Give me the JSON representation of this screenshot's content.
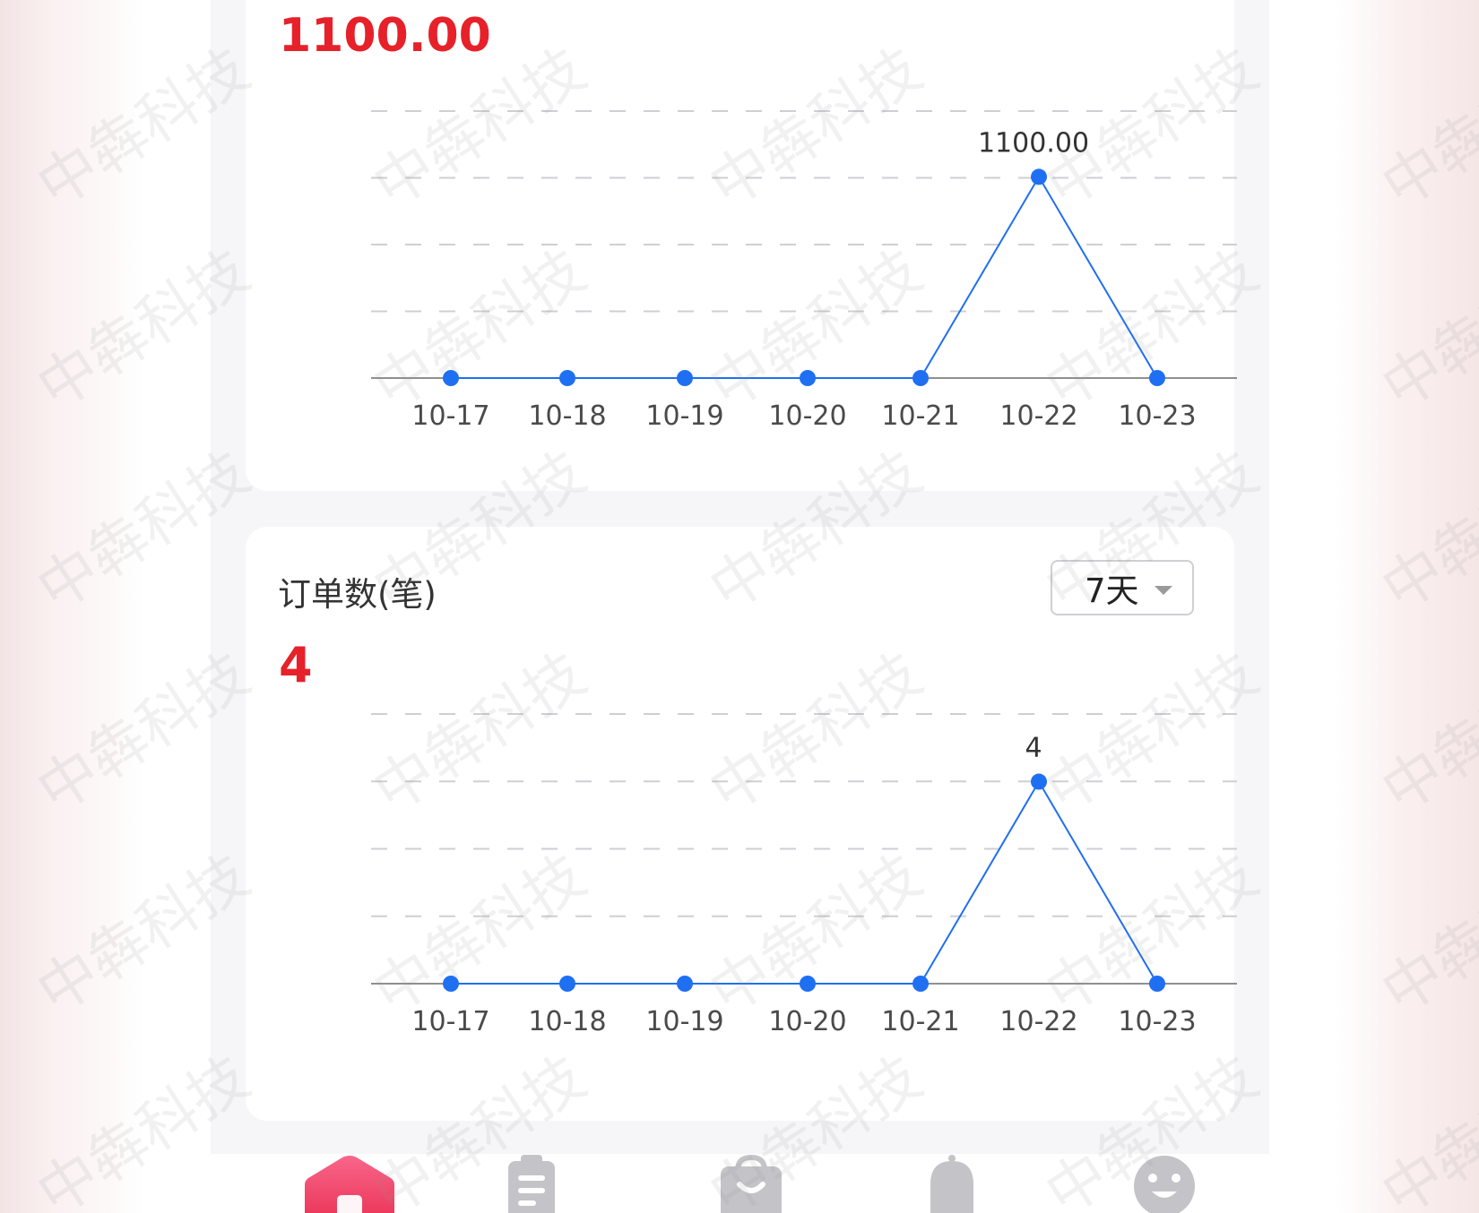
{
  "watermark_text": "中犇科技",
  "sales_card": {
    "value": "1100.00"
  },
  "orders_card": {
    "title": "订单数(笔)",
    "value": "4",
    "range_selected": "7天"
  },
  "chart_data": [
    {
      "type": "line",
      "categories": [
        "10-17",
        "10-18",
        "10-19",
        "10-20",
        "10-21",
        "10-22",
        "10-23"
      ],
      "values": [
        0,
        0,
        0,
        0,
        0,
        1100,
        0
      ],
      "point_label": "1100.00",
      "ylim": [
        0,
        1200
      ],
      "grid": true,
      "line_color": "#1f6ff2"
    },
    {
      "type": "line",
      "categories": [
        "10-17",
        "10-18",
        "10-19",
        "10-20",
        "10-21",
        "10-22",
        "10-23"
      ],
      "values": [
        0,
        0,
        0,
        0,
        0,
        4,
        0
      ],
      "point_label": "4",
      "ylim": [
        0,
        4.4
      ],
      "grid": true,
      "line_color": "#1f6ff2"
    }
  ],
  "tabbar": {
    "items": [
      {
        "icon": "home-icon",
        "active": true
      },
      {
        "icon": "clipboard-icon",
        "active": false
      },
      {
        "icon": "shopping-bag-icon",
        "active": false
      },
      {
        "icon": "bell-icon",
        "active": false
      },
      {
        "icon": "smiley-icon",
        "active": false
      }
    ],
    "active_color": "#f04a6c",
    "inactive_color": "#c4c4c8"
  }
}
